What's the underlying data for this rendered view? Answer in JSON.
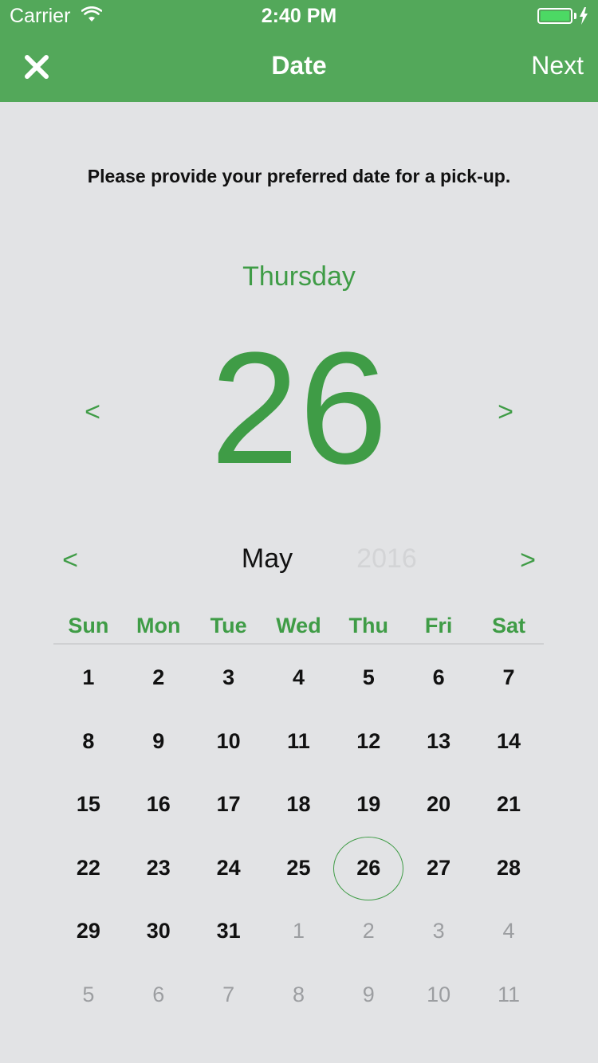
{
  "status_bar": {
    "carrier": "Carrier",
    "time": "2:40 PM",
    "battery_level": 1.0
  },
  "nav": {
    "close_icon": "close-x-icon",
    "title": "Date",
    "next_label": "Next"
  },
  "prompt": "Please provide your preferred date for a pick-up.",
  "selected": {
    "weekday": "Thursday",
    "day": "26"
  },
  "arrows": {
    "prev": "<",
    "next": ">"
  },
  "month_bar": {
    "month": "May",
    "year": "2016"
  },
  "weekdays": [
    "Sun",
    "Mon",
    "Tue",
    "Wed",
    "Thu",
    "Fri",
    "Sat"
  ],
  "weeks": [
    [
      {
        "d": "1"
      },
      {
        "d": "2"
      },
      {
        "d": "3"
      },
      {
        "d": "4"
      },
      {
        "d": "5"
      },
      {
        "d": "6"
      },
      {
        "d": "7"
      }
    ],
    [
      {
        "d": "8"
      },
      {
        "d": "9"
      },
      {
        "d": "10"
      },
      {
        "d": "11"
      },
      {
        "d": "12"
      },
      {
        "d": "13"
      },
      {
        "d": "14"
      }
    ],
    [
      {
        "d": "15"
      },
      {
        "d": "16"
      },
      {
        "d": "17"
      },
      {
        "d": "18"
      },
      {
        "d": "19"
      },
      {
        "d": "20"
      },
      {
        "d": "21"
      }
    ],
    [
      {
        "d": "22"
      },
      {
        "d": "23"
      },
      {
        "d": "24"
      },
      {
        "d": "25"
      },
      {
        "d": "26",
        "selected": true
      },
      {
        "d": "27"
      },
      {
        "d": "28"
      }
    ],
    [
      {
        "d": "29"
      },
      {
        "d": "30"
      },
      {
        "d": "31"
      },
      {
        "d": "1",
        "other": true
      },
      {
        "d": "2",
        "other": true
      },
      {
        "d": "3",
        "other": true
      },
      {
        "d": "4",
        "other": true
      }
    ],
    [
      {
        "d": "5",
        "other": true
      },
      {
        "d": "6",
        "other": true
      },
      {
        "d": "7",
        "other": true
      },
      {
        "d": "8",
        "other": true
      },
      {
        "d": "9",
        "other": true
      },
      {
        "d": "10",
        "other": true
      },
      {
        "d": "11",
        "other": true
      }
    ]
  ],
  "colors": {
    "nav_green": "#53a85a",
    "accent_green": "#3f9c46",
    "background": "#e2e3e5",
    "other_month_text": "#9c9ea1",
    "year_text": "#d3d4d6"
  }
}
